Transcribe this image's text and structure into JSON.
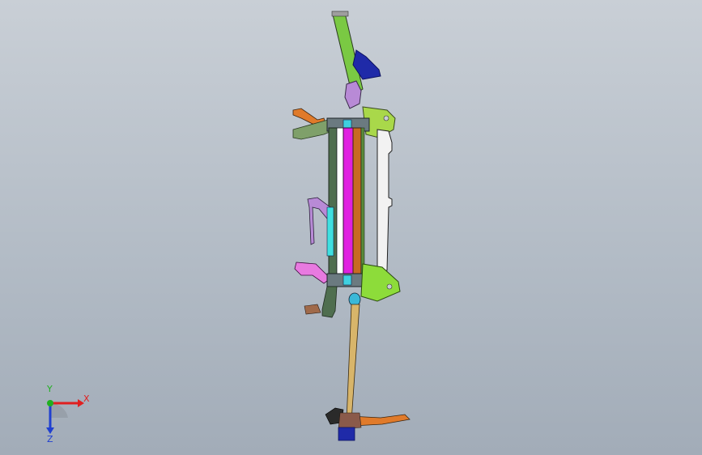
{
  "viewport": {
    "colors": {
      "background_top": "#c9cfd6",
      "background_bottom": "#a2acb8",
      "green_arm": "#7ac943",
      "blue_bracket": "#1f2aa8",
      "magenta_rod": "#e020e0",
      "orange_rod": "#c86a22",
      "dark_green_rod": "#4f6e4f",
      "cyan_rod": "#40e0e0",
      "white_panel": "#f2f2f2",
      "tan_shaft": "#d8b56a",
      "lavender_part": "#b88ad6",
      "pink_part": "#e87ae0",
      "bright_green_plate": "#8ddc3a"
    }
  },
  "triad": {
    "x_label": "X",
    "y_label": "Y",
    "z_label": "Z",
    "colors": {
      "x": "#e02020",
      "y": "#20b020",
      "z": "#2040d0"
    }
  }
}
